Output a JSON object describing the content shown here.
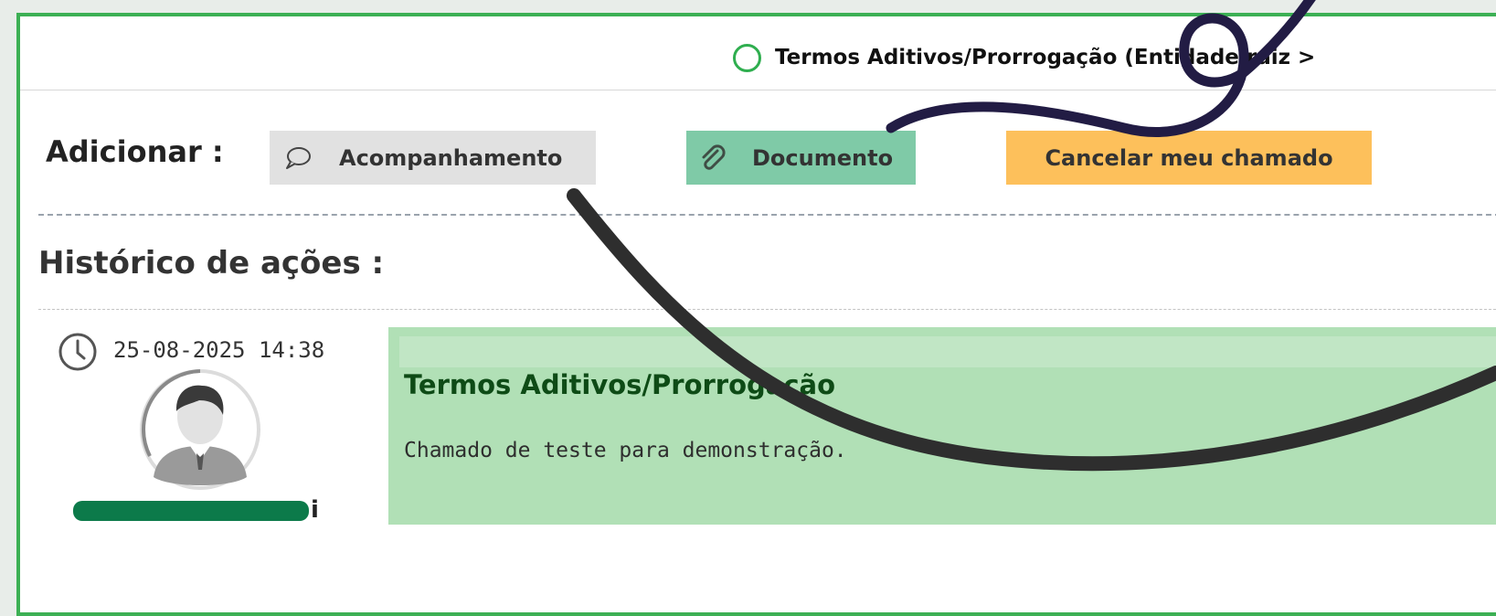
{
  "header": {
    "ticket_title": "Termos Aditivos/Prorrogação (Entidade raiz >"
  },
  "actions": {
    "add_label": "Adicionar :",
    "followup_label": "Acompanhamento",
    "document_label": "Documento",
    "cancel_label": "Cancelar meu chamado"
  },
  "history": {
    "label": "Histórico de ações :",
    "entries": [
      {
        "date": "25-08-2025 14:38",
        "author_suffix": "i",
        "title": "Termos Aditivos/Prorrogação",
        "content": "Chamado de teste para demonstração."
      }
    ]
  },
  "colors": {
    "frame_border": "#3cb054",
    "followup_button": "#e1e1e1",
    "document_button": "#7fcaa7",
    "cancel_button": "#fdc05b",
    "entry_background": "#b1e0b6",
    "status_circle": "#2fae4f"
  },
  "icons": {
    "status": "circle-outline-icon",
    "followup": "speech-bubble-icon",
    "document": "paperclip-icon",
    "timestamp": "clock-icon",
    "author": "user-avatar-icon"
  }
}
